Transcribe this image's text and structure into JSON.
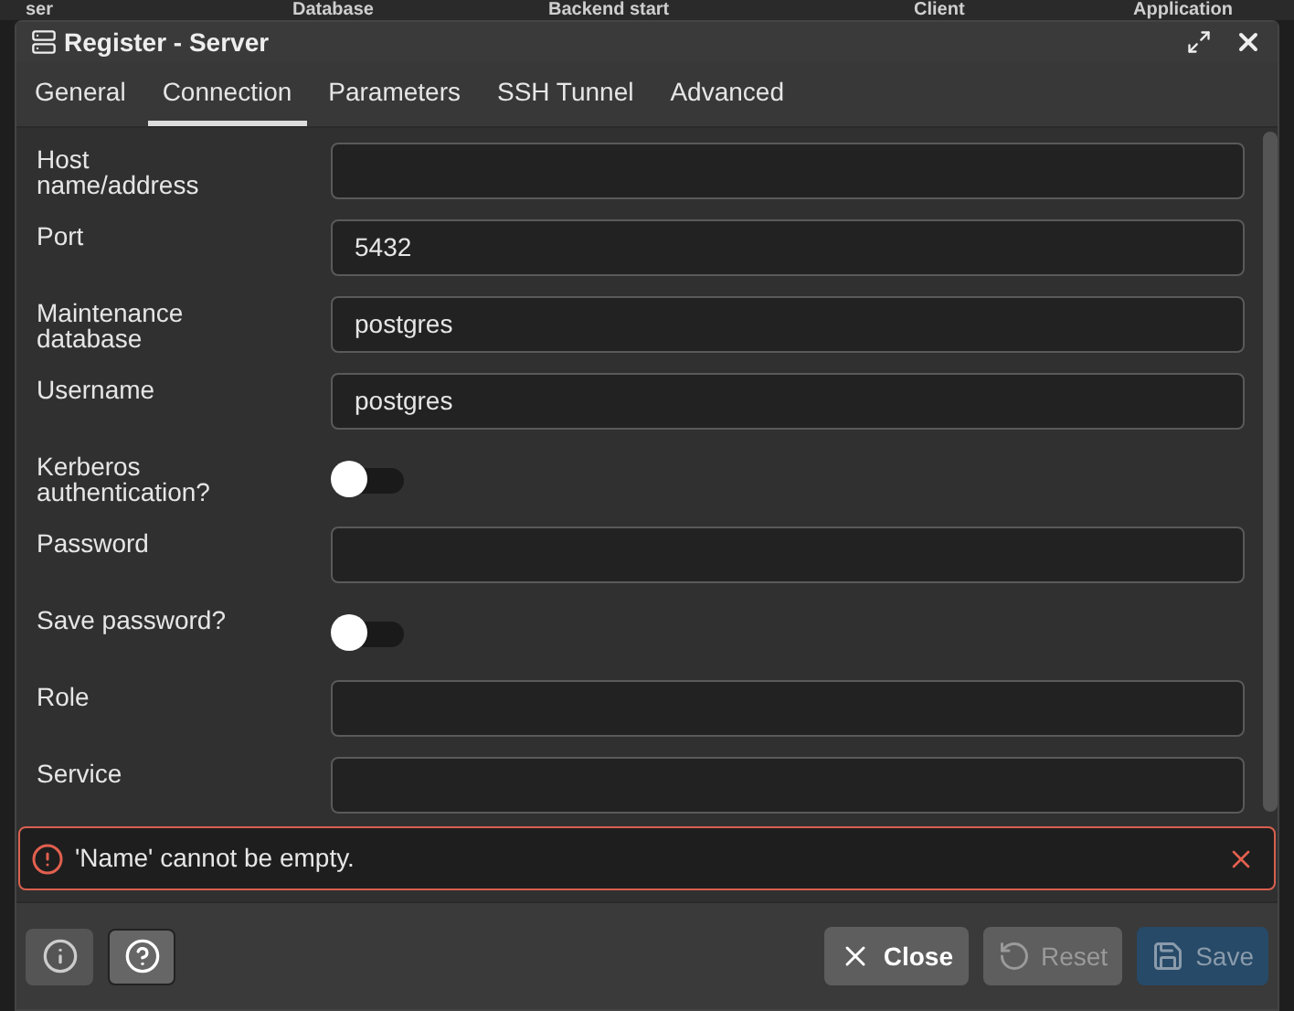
{
  "background_table": {
    "columns": [
      "ser",
      "Database",
      "Backend start",
      "Client",
      "Application"
    ]
  },
  "dialog": {
    "title": "Register - Server"
  },
  "tabs": [
    {
      "label": "General",
      "selected": false
    },
    {
      "label": "Connection",
      "selected": true
    },
    {
      "label": "Parameters",
      "selected": false
    },
    {
      "label": "SSH Tunnel",
      "selected": false
    },
    {
      "label": "Advanced",
      "selected": false
    }
  ],
  "fields": [
    {
      "kind": "text",
      "label": "Host name/address"
    },
    {
      "kind": "text",
      "label": "Port",
      "value": "5432"
    },
    {
      "kind": "text",
      "label": "Maintenance database",
      "value": "postgres"
    },
    {
      "kind": "text",
      "label": "Username",
      "value": "postgres"
    },
    {
      "kind": "switch",
      "label": "Kerberos authentication?",
      "on": false
    },
    {
      "kind": "text",
      "label": "Password"
    },
    {
      "kind": "switch",
      "label": "Save password?",
      "on": false
    },
    {
      "kind": "text",
      "label": "Role"
    },
    {
      "kind": "text",
      "label": "Service"
    }
  ],
  "error": {
    "message": "'Name' cannot be empty."
  },
  "footer": {
    "buttons": [
      {
        "kind": "close",
        "label": "Close",
        "disabled": false
      },
      {
        "kind": "reset",
        "label": "Reset",
        "disabled": true
      },
      {
        "kind": "save",
        "label": "Save",
        "disabled": true
      }
    ]
  }
}
